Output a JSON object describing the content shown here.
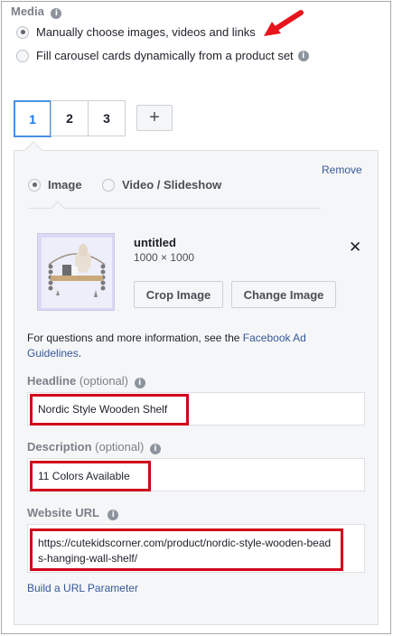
{
  "media": {
    "title": "Media",
    "options": [
      {
        "label": "Manually choose images, videos and links",
        "selected": true
      },
      {
        "label": "Fill carousel cards dynamically from a product set",
        "selected": false
      }
    ]
  },
  "cards": {
    "tabs": [
      "1",
      "2",
      "3"
    ],
    "active": "1",
    "add_symbol": "+"
  },
  "panel": {
    "remove_label": "Remove",
    "media_type_options": [
      {
        "label": "Image",
        "selected": true
      },
      {
        "label": "Video / Slideshow",
        "selected": false
      }
    ],
    "image": {
      "name": "untitled",
      "dimensions": "1000 × 1000",
      "crop_label": "Crop Image",
      "change_label": "Change Image",
      "close_symbol": "✕"
    },
    "help_text": "For questions and more information, see the ",
    "help_link": "Facebook Ad Guidelines",
    "help_end": ".",
    "headline": {
      "label": "Headline",
      "optional": "(optional)",
      "value": "Nordic Style Wooden Shelf"
    },
    "description": {
      "label": "Description",
      "optional": "(optional)",
      "value": "11 Colors Available"
    },
    "website_url": {
      "label": "Website URL",
      "value": "https://cutekidscorner.com/product/nordic-style-wooden-beads-hanging-wall-shelf/"
    },
    "url_param_link": "Build a URL Parameter"
  },
  "colors": {
    "accent_blue": "#4a90e2",
    "link_blue": "#365899",
    "highlight_red": "#d0021b"
  }
}
